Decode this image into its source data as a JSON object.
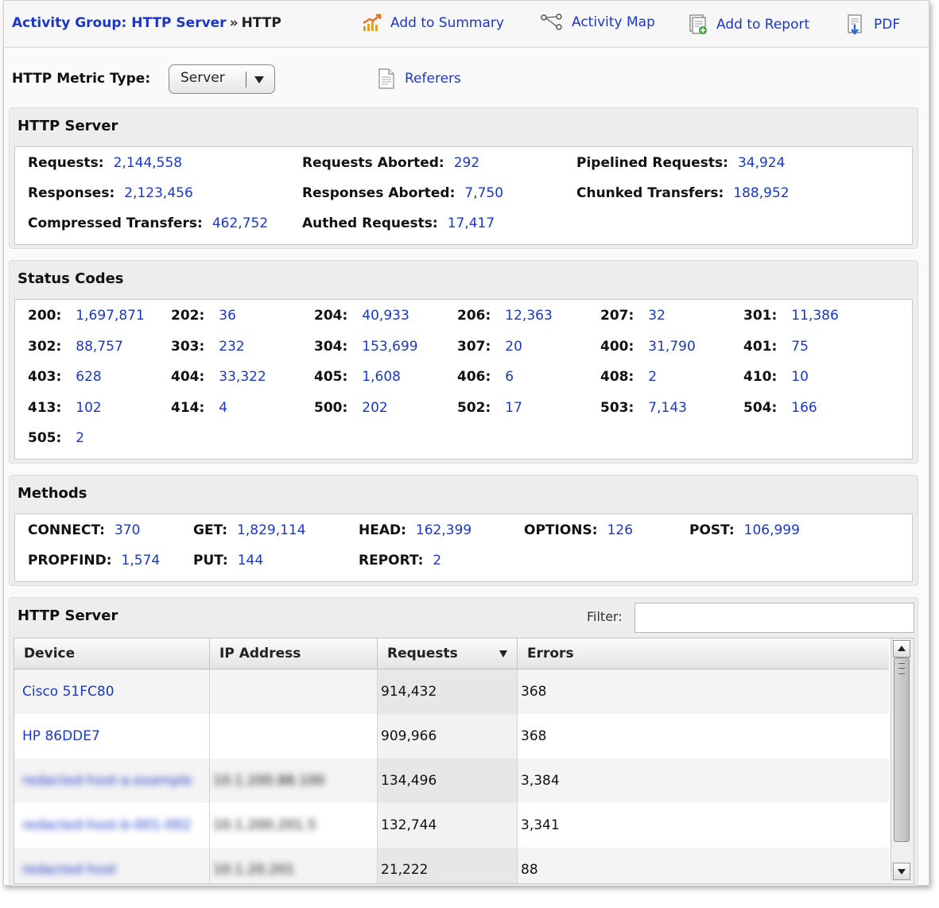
{
  "breadcrumb": {
    "group_label": "Activity Group: HTTP Server",
    "separator": "»",
    "current": "HTTP"
  },
  "toolbar": {
    "add_summary": "Add to Summary",
    "activity_map": "Activity Map",
    "add_report": "Add to Report",
    "pdf": "PDF"
  },
  "metric_type": {
    "label": "HTTP Metric Type:",
    "selected": "Server",
    "referers": "Referers"
  },
  "http_server": {
    "title": "HTTP Server",
    "stats": [
      {
        "k": "Requests:",
        "v": "2,144,558"
      },
      {
        "k": "Requests Aborted:",
        "v": "292"
      },
      {
        "k": "Pipelined Requests:",
        "v": "34,924"
      },
      {
        "k": "Responses:",
        "v": "2,123,456"
      },
      {
        "k": "Responses Aborted:",
        "v": "7,750"
      },
      {
        "k": "Chunked Transfers:",
        "v": "188,952"
      },
      {
        "k": "Compressed Transfers:",
        "v": "462,752"
      },
      {
        "k": "Authed Requests:",
        "v": "17,417"
      }
    ]
  },
  "status_codes": {
    "title": "Status Codes",
    "codes": [
      {
        "k": "200:",
        "v": "1,697,871"
      },
      {
        "k": "202:",
        "v": "36"
      },
      {
        "k": "204:",
        "v": "40,933"
      },
      {
        "k": "206:",
        "v": "12,363"
      },
      {
        "k": "207:",
        "v": "32"
      },
      {
        "k": "301:",
        "v": "11,386"
      },
      {
        "k": "302:",
        "v": "88,757"
      },
      {
        "k": "303:",
        "v": "232"
      },
      {
        "k": "304:",
        "v": "153,699"
      },
      {
        "k": "307:",
        "v": "20"
      },
      {
        "k": "400:",
        "v": "31,790"
      },
      {
        "k": "401:",
        "v": "75"
      },
      {
        "k": "403:",
        "v": "628"
      },
      {
        "k": "404:",
        "v": "33,322"
      },
      {
        "k": "405:",
        "v": "1,608"
      },
      {
        "k": "406:",
        "v": "6"
      },
      {
        "k": "408:",
        "v": "2"
      },
      {
        "k": "410:",
        "v": "10"
      },
      {
        "k": "413:",
        "v": "102"
      },
      {
        "k": "414:",
        "v": "4"
      },
      {
        "k": "500:",
        "v": "202"
      },
      {
        "k": "502:",
        "v": "17"
      },
      {
        "k": "503:",
        "v": "7,143"
      },
      {
        "k": "504:",
        "v": "166"
      },
      {
        "k": "505:",
        "v": "2"
      }
    ]
  },
  "methods": {
    "title": "Methods",
    "items": [
      {
        "k": "CONNECT:",
        "v": "370"
      },
      {
        "k": "GET:",
        "v": "1,829,114"
      },
      {
        "k": "HEAD:",
        "v": "162,399"
      },
      {
        "k": "OPTIONS:",
        "v": "126"
      },
      {
        "k": "POST:",
        "v": "106,999"
      },
      {
        "k": "PROPFIND:",
        "v": "1,574"
      },
      {
        "k": "PUT:",
        "v": "144"
      },
      {
        "k": "REPORT:",
        "v": "2"
      }
    ]
  },
  "device_table": {
    "title": "HTTP Server",
    "filter_label": "Filter:",
    "filter_value": "",
    "columns": [
      "Device",
      "IP Address",
      "Requests",
      "Errors"
    ],
    "rows": [
      {
        "device": "Cisco 51FC80",
        "ip": "",
        "requests": "914,432",
        "errors": "368",
        "redacted": false
      },
      {
        "device": "HP 86DDE7",
        "ip": "",
        "requests": "909,966",
        "errors": "368",
        "redacted": false
      },
      {
        "device": "redacted-host-a.example",
        "ip": "10.1.200.88.100",
        "requests": "134,496",
        "errors": "3,384",
        "redacted": true
      },
      {
        "device": "redacted-host-b-001-002",
        "ip": "10.1.200.201.5",
        "requests": "132,744",
        "errors": "3,341",
        "redacted": true
      },
      {
        "device": "redacted-host",
        "ip": "10.1.20.201",
        "requests": "21,222",
        "errors": "88",
        "redacted": true
      }
    ]
  },
  "colors": {
    "link": "#1a37c8",
    "panel": "#ededed"
  }
}
